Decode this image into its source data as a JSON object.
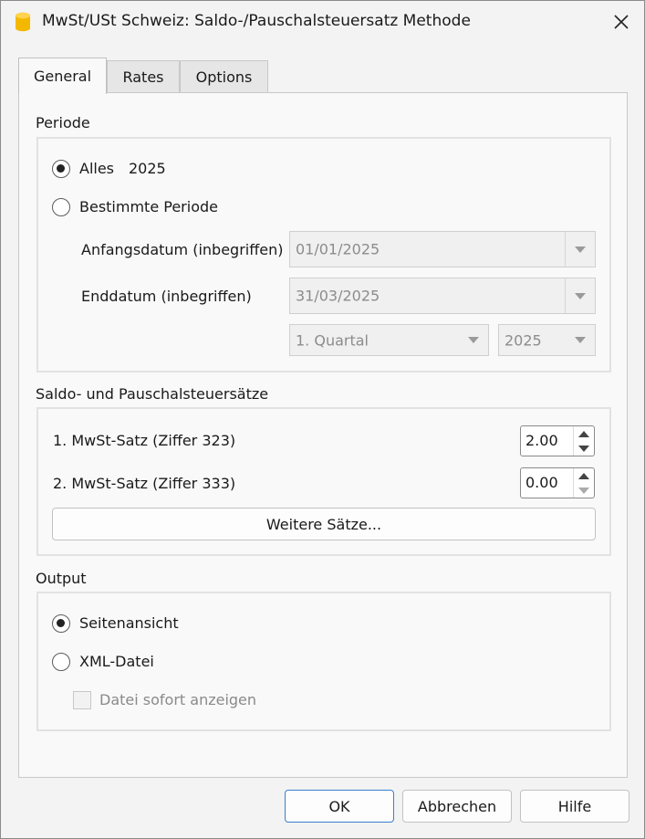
{
  "window": {
    "title": "MwSt/USt Schweiz: Saldo-/Pauschalsteuersatz Methode"
  },
  "tabs": [
    "General",
    "Rates",
    "Options"
  ],
  "periode": {
    "label": "Periode",
    "alles_label": "Alles",
    "alles_year": "2025",
    "bestimmte_label": "Bestimmte Periode",
    "anfang_label": "Anfangsdatum (inbegriffen)",
    "anfang_value": "01/01/2025",
    "end_label": "Enddatum (inbegriffen)",
    "end_value": "31/03/2025",
    "quartal_value": "1. Quartal",
    "year_value": "2025"
  },
  "saetze": {
    "label": "Saldo- und Pauschalsteuersätze",
    "rate1_label": "1. MwSt-Satz (Ziffer 323)",
    "rate1_value": "2.00",
    "rate2_label": "2. MwSt-Satz (Ziffer 333)",
    "rate2_value": "0.00",
    "weitere_button": "Weitere Sätze..."
  },
  "output": {
    "label": "Output",
    "seitenansicht_label": "Seitenansicht",
    "xml_label": "XML-Datei",
    "datei_label": "Datei sofort anzeigen"
  },
  "footer": {
    "ok": "OK",
    "abbrechen": "Abbrechen",
    "hilfe": "Hilfe"
  },
  "colors": {
    "accent": "#3b7fcf",
    "app_icon": "#f5b800"
  }
}
